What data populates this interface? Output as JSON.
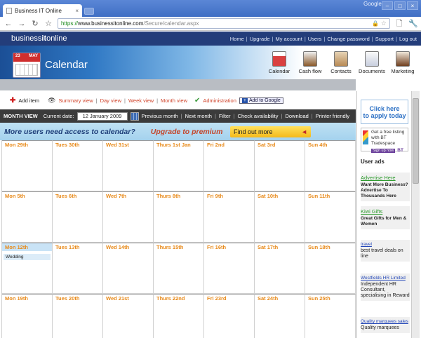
{
  "browser": {
    "tab_title": "Business IT Online",
    "tab_close": "×",
    "account_name": "Google",
    "window_controls": [
      "–",
      "□",
      "×"
    ],
    "url_scheme": "https://",
    "url_host": "www.businessitonline.com",
    "url_path": "/Secure/calendar.aspx",
    "nav_icons": [
      "back-icon",
      "forward-icon",
      "reload-icon",
      "star-icon",
      "lock-icon",
      "page-icon",
      "wrench-icon"
    ],
    "glyphs": {
      "back": "←",
      "forward": "→",
      "reload": "↻",
      "star": "☆",
      "lock": "🔒",
      "star_url": "☆",
      "page": "🗋",
      "wrench": "🔧"
    }
  },
  "site": {
    "logo_a": "business",
    "logo_b": "it",
    "logo_c": "online",
    "top_links": [
      "Home",
      "Upgrade",
      "My account",
      "Users",
      "Change password",
      "Support",
      "Log out"
    ],
    "separator": "|",
    "banner_title": "Calendar",
    "cal_icon_left": "23",
    "cal_icon_right": "MAY",
    "modules": [
      "Calendar",
      "Cash flow",
      "Contacts",
      "Documents",
      "Marketing"
    ]
  },
  "toolbar": {
    "add_item": "Add item",
    "plus_glyph": "✚",
    "eye_glyph": "👁",
    "check_glyph": "✔",
    "views": [
      "Summary view",
      "Day view",
      "Week view",
      "Month view"
    ],
    "administration": "Administration",
    "add_google": "Add to Google",
    "google_plus": "+"
  },
  "month_bar": {
    "label": "MONTH VIEW",
    "current_date_label": "Current date:",
    "current_date": "12 January 2009",
    "previous": "Previous month",
    "next": "Next month",
    "filter": "Filter",
    "check": "Check availability",
    "download": "Download",
    "printer": "Printer friendly"
  },
  "promo": {
    "text": "More users need access to calendar?",
    "upgrade": "Upgrade to premium",
    "button": "Find out more",
    "arrow": "◄"
  },
  "calendar": {
    "weeks": [
      [
        "Mon 29th",
        "Tues 30th",
        "Wed 31st",
        "Thurs 1st Jan",
        "Fri 2nd",
        "Sat 3rd",
        "Sun 4th"
      ],
      [
        "Mon 5th",
        "Tues 6th",
        "Wed 7th",
        "Thurs 8th",
        "Fri 9th",
        "Sat 10th",
        "Sun 11th"
      ],
      [
        "Mon 12th",
        "Tues 13th",
        "Wed 14th",
        "Thurs 15th",
        "Fri 16th",
        "Sat 17th",
        "Sun 18th"
      ],
      [
        "Mon 19th",
        "Tues 20th",
        "Wed 21st",
        "Thurs 22nd",
        "Fri 23rd",
        "Sat 24th",
        "Sun 25th"
      ]
    ],
    "today": "Mon 12th",
    "event": "Wedding"
  },
  "sidebar": {
    "click_here": "Click here",
    "to_apply": "to apply today",
    "bt_line1": "Get a free listing",
    "bt_line2": "with BT Tradespace",
    "bt_signup": "Sign up now",
    "bt_logo": "BT",
    "user_ads": "User ads",
    "ads": [
      {
        "title": "Advertise Here",
        "body": "Want More Business? Advertise To Thousands Here"
      },
      {
        "title": "Kiwi Gifts",
        "body": "Great Gifts for Men & Women"
      },
      {
        "title": "travel",
        "body": "best travel deals on line"
      },
      {
        "title": "Westfields HR Limited",
        "body": "Independent HR Consultant, specialising in Reward"
      },
      {
        "title": "Quality marquees sales",
        "body": "Quality marquees"
      }
    ]
  }
}
